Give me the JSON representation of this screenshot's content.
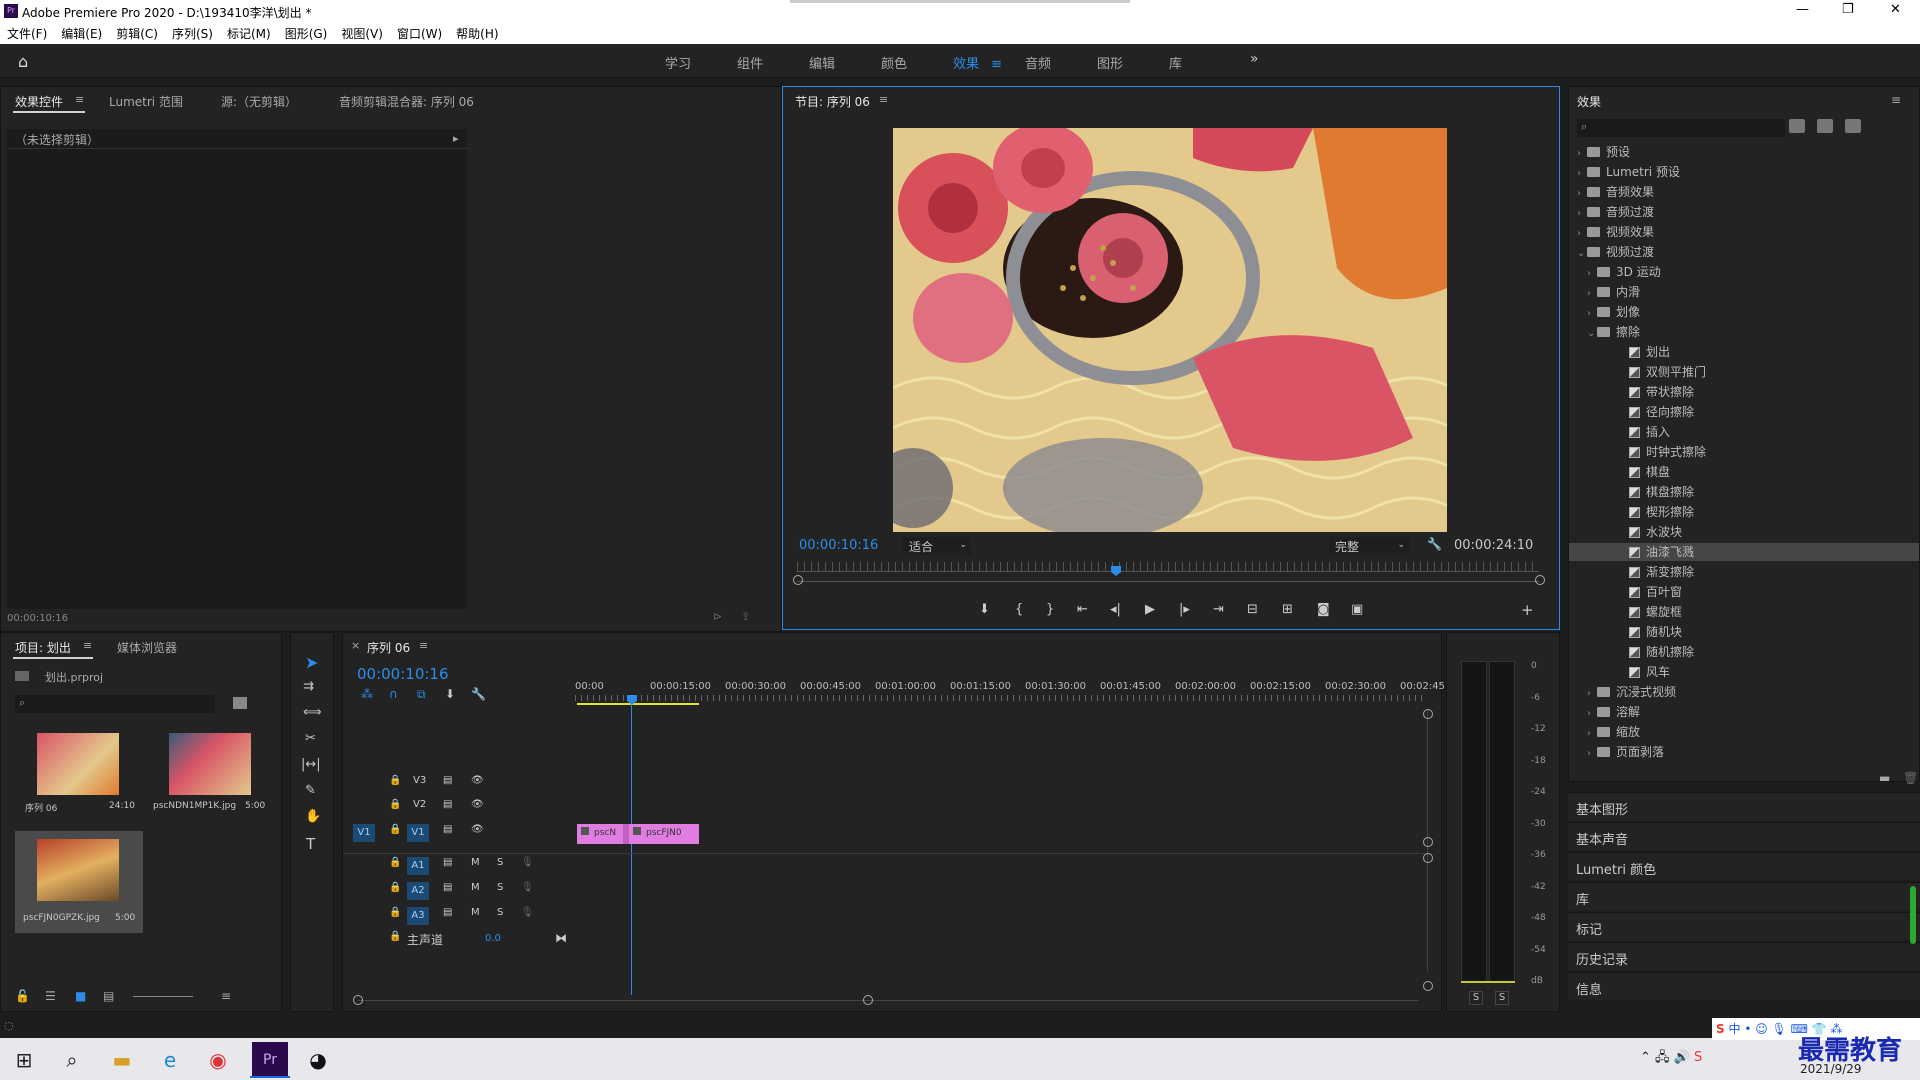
{
  "title": {
    "app_icon": "Pr",
    "text": "Adobe Premiere Pro 2020 - D:\\193410李洋\\划出 *"
  },
  "menu": [
    "文件(F)",
    "编辑(E)",
    "剪辑(C)",
    "序列(S)",
    "标记(M)",
    "图形(G)",
    "视图(V)",
    "窗口(W)",
    "帮助(H)"
  ],
  "workspaces": [
    "学习",
    "组件",
    "编辑",
    "颜色",
    "效果",
    "音频",
    "图形",
    "库"
  ],
  "active_workspace": "效果",
  "effect_controls": {
    "tabs": [
      "效果控件",
      "Lumetri 范围",
      "源:（无剪辑）",
      "音频剪辑混合器: 序列 06"
    ],
    "no_clip": "（未选择剪辑）",
    "timecode": "00:00:10:16"
  },
  "program": {
    "title": "节目: 序列 06",
    "timecode": "00:00:10:16",
    "fit": "适合",
    "quality": "完整",
    "duration": "00:00:24:10",
    "playhead_fraction": 0.43
  },
  "project": {
    "tabs": [
      "项目: 划出",
      "媒体浏览器"
    ],
    "file": "划出.prproj",
    "items": [
      {
        "name": "序列 06",
        "dur": "24:10"
      },
      {
        "name": "pscNDN1MP1K.jpg",
        "dur": "5:00"
      },
      {
        "name": "pscFJN0GPZK.jpg",
        "dur": "5:00"
      }
    ]
  },
  "timeline": {
    "tab": "序列 06",
    "timecode": "00:00:10:16",
    "ruler": [
      "00:00",
      "00:00:15:00",
      "00:00:30:00",
      "00:00:45:00",
      "00:01:00:00",
      "00:01:15:00",
      "00:01:30:00",
      "00:01:45:00",
      "00:02:00:00",
      "00:02:15:00",
      "00:02:30:00",
      "00:02:45:"
    ],
    "video_tracks": [
      "V3",
      "V2",
      "V1"
    ],
    "audio_tracks": [
      "A1",
      "A2",
      "A3"
    ],
    "master": "主声道",
    "master_val": "0.0",
    "src_patch": "V1",
    "clips": [
      "pscN",
      "pscFJN0"
    ]
  },
  "meter": {
    "scale": [
      "0",
      "-6",
      "-12",
      "-18",
      "-24",
      "-30",
      "-36",
      "-42",
      "-48",
      "-54",
      "dB"
    ],
    "solo": [
      "S",
      "S"
    ]
  },
  "effects": {
    "title": "效果",
    "tree": [
      {
        "label": "预设",
        "level": 0,
        "type": "folder",
        "open": false
      },
      {
        "label": "Lumetri 预设",
        "level": 0,
        "type": "folder",
        "open": false
      },
      {
        "label": "音频效果",
        "level": 0,
        "type": "folder",
        "open": false
      },
      {
        "label": "音频过渡",
        "level": 0,
        "type": "folder",
        "open": false
      },
      {
        "label": "视频效果",
        "level": 0,
        "type": "folder",
        "open": false
      },
      {
        "label": "视频过渡",
        "level": 0,
        "type": "folder",
        "open": true
      },
      {
        "label": "3D 运动",
        "level": 1,
        "type": "folder",
        "open": false
      },
      {
        "label": "内滑",
        "level": 1,
        "type": "folder",
        "open": false
      },
      {
        "label": "划像",
        "level": 1,
        "type": "folder",
        "open": false
      },
      {
        "label": "擦除",
        "level": 1,
        "type": "folder",
        "open": true
      },
      {
        "label": "划出",
        "level": 2,
        "type": "fx"
      },
      {
        "label": "双侧平推门",
        "level": 2,
        "type": "fx"
      },
      {
        "label": "带状擦除",
        "level": 2,
        "type": "fx"
      },
      {
        "label": "径向擦除",
        "level": 2,
        "type": "fx"
      },
      {
        "label": "插入",
        "level": 2,
        "type": "fx"
      },
      {
        "label": "时钟式擦除",
        "level": 2,
        "type": "fx"
      },
      {
        "label": "棋盘",
        "level": 2,
        "type": "fx"
      },
      {
        "label": "棋盘擦除",
        "level": 2,
        "type": "fx"
      },
      {
        "label": "楔形擦除",
        "level": 2,
        "type": "fx"
      },
      {
        "label": "水波块",
        "level": 2,
        "type": "fx"
      },
      {
        "label": "油漆飞溅",
        "level": 2,
        "type": "fx",
        "selected": true
      },
      {
        "label": "渐变擦除",
        "level": 2,
        "type": "fx"
      },
      {
        "label": "百叶窗",
        "level": 2,
        "type": "fx"
      },
      {
        "label": "螺旋框",
        "level": 2,
        "type": "fx"
      },
      {
        "label": "随机块",
        "level": 2,
        "type": "fx"
      },
      {
        "label": "随机擦除",
        "level": 2,
        "type": "fx"
      },
      {
        "label": "风车",
        "level": 2,
        "type": "fx"
      },
      {
        "label": "沉浸式视频",
        "level": 1,
        "type": "folder",
        "open": false
      },
      {
        "label": "溶解",
        "level": 1,
        "type": "folder",
        "open": false
      },
      {
        "label": "缩放",
        "level": 1,
        "type": "folder",
        "open": false
      },
      {
        "label": "页面剥落",
        "level": 1,
        "type": "folder",
        "open": false
      }
    ]
  },
  "side_panels": [
    "基本图形",
    "基本声音",
    "Lumetri 颜色",
    "库",
    "标记",
    "历史记录",
    "信息"
  ],
  "watermark": "最需教育",
  "taskbar": {
    "date": "2021/9/29",
    "ime": "中"
  }
}
